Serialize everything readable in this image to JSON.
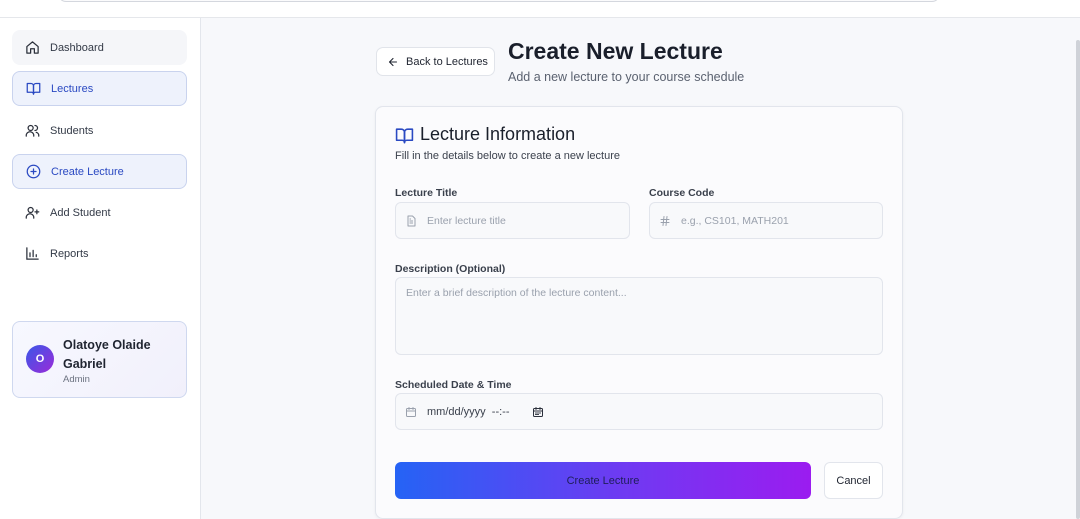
{
  "sidebar": {
    "items": [
      {
        "label": "Dashboard",
        "icon": "home-icon",
        "state": "plain"
      },
      {
        "label": "Lectures",
        "icon": "book-icon",
        "state": "active"
      },
      {
        "label": "Students",
        "icon": "users-icon",
        "state": "none"
      },
      {
        "label": "Create Lecture",
        "icon": "plus-circle-icon",
        "state": "active"
      },
      {
        "label": "Add Student",
        "icon": "user-plus-icon",
        "state": "none"
      },
      {
        "label": "Reports",
        "icon": "bar-chart-icon",
        "state": "none"
      }
    ],
    "user": {
      "initial": "O",
      "name": "Olatoye Olaide Gabriel",
      "role": "Admin"
    }
  },
  "header": {
    "back_label": "Back to Lectures",
    "title": "Create New Lecture",
    "subtitle": "Add a new lecture to your course schedule"
  },
  "form": {
    "title": "Lecture Information",
    "subtitle": "Fill in the details below to create a new lecture",
    "lecture_title": {
      "label": "Lecture Title",
      "placeholder": "Enter lecture title",
      "value": ""
    },
    "course_code": {
      "label": "Course Code",
      "placeholder": "e.g., CS101, MATH201",
      "value": ""
    },
    "description": {
      "label": "Description (Optional)",
      "placeholder": "Enter a brief description of the lecture content...",
      "value": ""
    },
    "scheduled": {
      "label": "Scheduled Date & Time",
      "value": "mm/dd/yyyy  --:--"
    },
    "submit_label": "Create Lecture",
    "cancel_label": "Cancel"
  },
  "colors": {
    "accent": "#2a49c2",
    "active_bg": "#eef2fc",
    "gradient_start": "#2563f5",
    "gradient_end": "#9b1cf0"
  }
}
